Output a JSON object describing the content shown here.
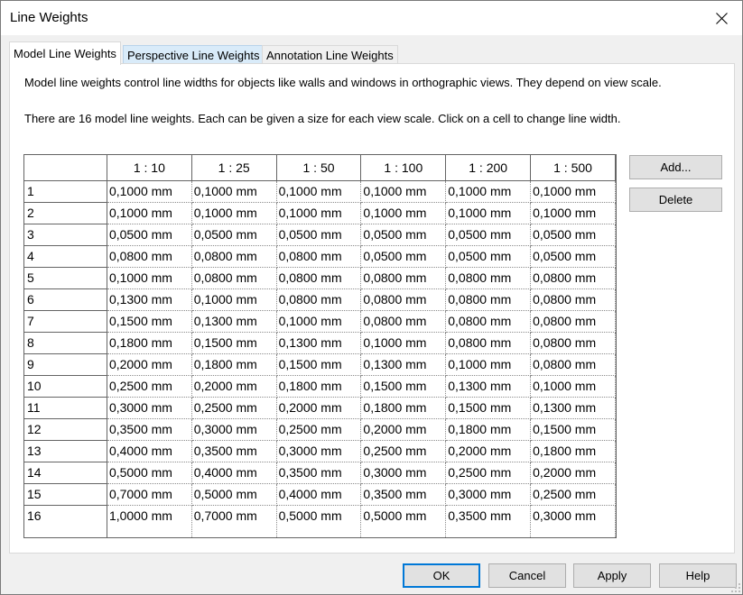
{
  "window": {
    "title": "Line Weights"
  },
  "tabs": [
    {
      "label": "Model Line Weights"
    },
    {
      "label": "Perspective Line Weights"
    },
    {
      "label": "Annotation Line Weights"
    }
  ],
  "description": {
    "line1": "Model line weights control line widths for objects like walls and windows in orthographic views. They depend on view scale.",
    "line2": "There are 16 model line weights. Each can be given a size for each view scale. Click on a cell to change line width."
  },
  "grid": {
    "columns": [
      "1 : 10",
      "1 : 25",
      "1 : 50",
      "1 : 100",
      "1 : 200",
      "1 : 500"
    ],
    "rows": [
      {
        "label": "1",
        "values": [
          "0,1000 mm",
          "0,1000 mm",
          "0,1000 mm",
          "0,1000 mm",
          "0,1000 mm",
          "0,1000 mm"
        ]
      },
      {
        "label": "2",
        "values": [
          "0,1000 mm",
          "0,1000 mm",
          "0,1000 mm",
          "0,1000 mm",
          "0,1000 mm",
          "0,1000 mm"
        ]
      },
      {
        "label": "3",
        "values": [
          "0,0500 mm",
          "0,0500 mm",
          "0,0500 mm",
          "0,0500 mm",
          "0,0500 mm",
          "0,0500 mm"
        ]
      },
      {
        "label": "4",
        "values": [
          "0,0800 mm",
          "0,0800 mm",
          "0,0800 mm",
          "0,0500 mm",
          "0,0500 mm",
          "0,0500 mm"
        ]
      },
      {
        "label": "5",
        "values": [
          "0,1000 mm",
          "0,0800 mm",
          "0,0800 mm",
          "0,0800 mm",
          "0,0800 mm",
          "0,0800 mm"
        ]
      },
      {
        "label": "6",
        "values": [
          "0,1300 mm",
          "0,1000 mm",
          "0,0800 mm",
          "0,0800 mm",
          "0,0800 mm",
          "0,0800 mm"
        ]
      },
      {
        "label": "7",
        "values": [
          "0,1500 mm",
          "0,1300 mm",
          "0,1000 mm",
          "0,0800 mm",
          "0,0800 mm",
          "0,0800 mm"
        ]
      },
      {
        "label": "8",
        "values": [
          "0,1800 mm",
          "0,1500 mm",
          "0,1300 mm",
          "0,1000 mm",
          "0,0800 mm",
          "0,0800 mm"
        ]
      },
      {
        "label": "9",
        "values": [
          "0,2000 mm",
          "0,1800 mm",
          "0,1500 mm",
          "0,1300 mm",
          "0,1000 mm",
          "0,0800 mm"
        ]
      },
      {
        "label": "10",
        "values": [
          "0,2500 mm",
          "0,2000 mm",
          "0,1800 mm",
          "0,1500 mm",
          "0,1300 mm",
          "0,1000 mm"
        ]
      },
      {
        "label": "11",
        "values": [
          "0,3000 mm",
          "0,2500 mm",
          "0,2000 mm",
          "0,1800 mm",
          "0,1500 mm",
          "0,1300 mm"
        ]
      },
      {
        "label": "12",
        "values": [
          "0,3500 mm",
          "0,3000 mm",
          "0,2500 mm",
          "0,2000 mm",
          "0,1800 mm",
          "0,1500 mm"
        ]
      },
      {
        "label": "13",
        "values": [
          "0,4000 mm",
          "0,3500 mm",
          "0,3000 mm",
          "0,2500 mm",
          "0,2000 mm",
          "0,1800 mm"
        ]
      },
      {
        "label": "14",
        "values": [
          "0,5000 mm",
          "0,4000 mm",
          "0,3500 mm",
          "0,3000 mm",
          "0,2500 mm",
          "0,2000 mm"
        ]
      },
      {
        "label": "15",
        "values": [
          "0,7000 mm",
          "0,5000 mm",
          "0,4000 mm",
          "0,3500 mm",
          "0,3000 mm",
          "0,2500 mm"
        ]
      },
      {
        "label": "16",
        "values": [
          "1,0000 mm",
          "0,7000 mm",
          "0,5000 mm",
          "0,5000 mm",
          "0,3500 mm",
          "0,3000 mm"
        ]
      }
    ]
  },
  "side_buttons": {
    "add": "Add...",
    "delete": "Delete"
  },
  "footer": {
    "ok": "OK",
    "cancel": "Cancel",
    "apply": "Apply",
    "help": "Help"
  },
  "icons": {
    "close": "close-icon",
    "grip": "resize-grip-icon"
  },
  "colors": {
    "accent": "#0078d7",
    "tab_hover": "#d9ebf9"
  }
}
